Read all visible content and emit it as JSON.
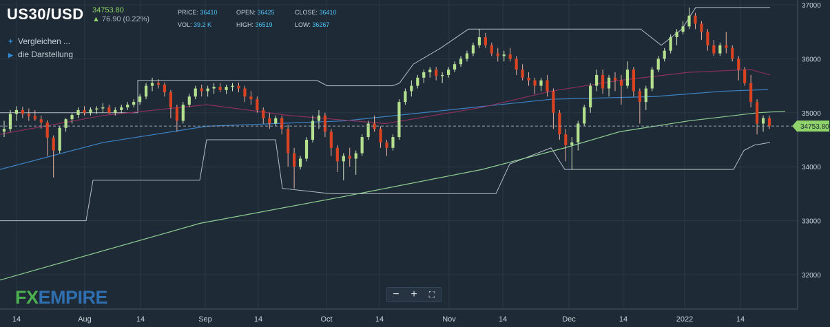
{
  "header": {
    "symbol": "US30/USD",
    "last_price": "34753.80",
    "change": "76.90 (0.22%)",
    "price_label": "PRICE:",
    "price": "36410",
    "open_label": "OPEN:",
    "open": "36425",
    "close_label": "CLOSE:",
    "close": "36410",
    "vol_label": "VOL:",
    "vol": "39.2 K",
    "high_label": "HIGH:",
    "high": "36519",
    "low_label": "LOW:",
    "low": "36267"
  },
  "menu": {
    "compare": "Vergleichen ...",
    "display": "die Darstellung"
  },
  "zoom": {
    "minus": "−",
    "plus": "+",
    "fullscreen": "⛶"
  },
  "logo": {
    "fx": "FX",
    "empire": "EMPIRE"
  },
  "colors": {
    "bg": "#1e2a36",
    "up": "#b5e08e",
    "down": "#d94322",
    "grid": "#2a3947",
    "axis_text": "#c9d1d9",
    "price_tag": "#8fd36a",
    "ma_long": "#8fcf93",
    "ma_mid": "#3d82c4",
    "ma_short": "#8a2f5c",
    "donchian": "#b7bec6"
  },
  "chart_data": {
    "type": "candlestick",
    "y_axis": {
      "min": 31500,
      "max": 37000,
      "ticks": [
        32000,
        33000,
        34000,
        35000,
        36000,
        37000
      ]
    },
    "x_labels": [
      "14",
      "Aug",
      "14",
      "Sep",
      "14",
      "Oct",
      "14",
      "Nov",
      "14",
      "Dec",
      "14",
      "2022",
      "14"
    ],
    "current_price": 34753.8,
    "current_price_label": "34753.80",
    "start": 34700,
    "candles": [
      [
        34650,
        34850,
        34550,
        34700
      ],
      [
        34700,
        35050,
        34650,
        34980
      ],
      [
        34980,
        35120,
        34850,
        35050
      ],
      [
        35050,
        35110,
        34900,
        34980
      ],
      [
        34980,
        35080,
        34850,
        34940
      ],
      [
        34940,
        35050,
        34850,
        34880
      ],
      [
        34880,
        34950,
        34700,
        34820
      ],
      [
        34820,
        34860,
        34200,
        34540
      ],
      [
        34540,
        34580,
        33800,
        34300
      ],
      [
        34300,
        34750,
        34250,
        34720
      ],
      [
        34720,
        34900,
        34650,
        34880
      ],
      [
        34880,
        35000,
        34800,
        34960
      ],
      [
        34960,
        35100,
        34900,
        35050
      ],
      [
        35050,
        35120,
        34950,
        35000
      ],
      [
        35000,
        35100,
        34950,
        35060
      ],
      [
        35060,
        35120,
        34980,
        35080
      ],
      [
        35080,
        35180,
        35000,
        35100
      ],
      [
        35100,
        35150,
        34980,
        35000
      ],
      [
        35000,
        35100,
        34950,
        35050
      ],
      [
        35050,
        35150,
        35000,
        35100
      ],
      [
        35100,
        35200,
        35050,
        35150
      ],
      [
        35150,
        35250,
        35100,
        35200
      ],
      [
        35200,
        35350,
        35150,
        35300
      ],
      [
        35300,
        35550,
        35250,
        35500
      ],
      [
        35500,
        35650,
        35400,
        35550
      ],
      [
        35550,
        35620,
        35450,
        35520
      ],
      [
        35520,
        35560,
        35300,
        35380
      ],
      [
        35380,
        35420,
        34900,
        35100
      ],
      [
        35100,
        35150,
        34650,
        34850
      ],
      [
        34850,
        35200,
        34800,
        35150
      ],
      [
        35150,
        35350,
        35100,
        35300
      ],
      [
        35300,
        35500,
        35250,
        35450
      ],
      [
        35450,
        35520,
        35300,
        35400
      ],
      [
        35400,
        35500,
        35300,
        35450
      ],
      [
        35450,
        35550,
        35350,
        35480
      ],
      [
        35480,
        35550,
        35380,
        35420
      ],
      [
        35420,
        35520,
        35350,
        35480
      ],
      [
        35480,
        35550,
        35400,
        35500
      ],
      [
        35500,
        35560,
        35380,
        35450
      ],
      [
        35450,
        35500,
        35200,
        35300
      ],
      [
        35300,
        35400,
        35150,
        35250
      ],
      [
        35250,
        35300,
        35000,
        35050
      ],
      [
        35050,
        35100,
        34800,
        34900
      ],
      [
        34900,
        35000,
        34700,
        34800
      ],
      [
        34800,
        34950,
        34750,
        34900
      ],
      [
        34900,
        34950,
        34600,
        34700
      ],
      [
        34700,
        34780,
        34000,
        34250
      ],
      [
        34250,
        34350,
        33600,
        34000
      ],
      [
        34000,
        34200,
        33950,
        34150
      ],
      [
        34150,
        34550,
        34100,
        34500
      ],
      [
        34500,
        34950,
        34450,
        34850
      ],
      [
        34850,
        35050,
        34700,
        34950
      ],
      [
        34950,
        35000,
        34550,
        34650
      ],
      [
        34650,
        34700,
        34200,
        34350
      ],
      [
        34350,
        34400,
        33900,
        34100
      ],
      [
        34100,
        34250,
        33750,
        34200
      ],
      [
        34200,
        34350,
        34000,
        34150
      ],
      [
        34150,
        34300,
        33850,
        34250
      ],
      [
        34250,
        34600,
        34200,
        34550
      ],
      [
        34550,
        34850,
        34500,
        34800
      ],
      [
        34800,
        34950,
        34650,
        34700
      ],
      [
        34700,
        34750,
        34350,
        34450
      ],
      [
        34450,
        34500,
        34200,
        34350
      ],
      [
        34350,
        34600,
        34300,
        34550
      ],
      [
        34550,
        35250,
        34500,
        35200
      ],
      [
        35200,
        35450,
        35150,
        35400
      ],
      [
        35400,
        35600,
        35300,
        35500
      ],
      [
        35500,
        35700,
        35450,
        35650
      ],
      [
        35650,
        35800,
        35550,
        35750
      ],
      [
        35750,
        35850,
        35650,
        35800
      ],
      [
        35800,
        35850,
        35600,
        35680
      ],
      [
        35680,
        35750,
        35550,
        35700
      ],
      [
        35700,
        35850,
        35650,
        35800
      ],
      [
        35800,
        35950,
        35750,
        35900
      ],
      [
        35900,
        36050,
        35850,
        36000
      ],
      [
        36000,
        36150,
        35950,
        36100
      ],
      [
        36100,
        36300,
        36050,
        36250
      ],
      [
        36250,
        36550,
        36200,
        36400
      ],
      [
        36400,
        36480,
        36200,
        36250
      ],
      [
        36250,
        36300,
        36050,
        36100
      ],
      [
        36100,
        36200,
        35950,
        36050
      ],
      [
        36050,
        36150,
        35950,
        36080
      ],
      [
        36080,
        36200,
        35950,
        36000
      ],
      [
        36000,
        36050,
        35700,
        35800
      ],
      [
        35800,
        35900,
        35600,
        35650
      ],
      [
        35650,
        35750,
        35500,
        35600
      ],
      [
        35600,
        35650,
        35350,
        35500
      ],
      [
        35500,
        35650,
        35400,
        35600
      ],
      [
        35600,
        35700,
        35300,
        35400
      ],
      [
        35400,
        35450,
        34700,
        35000
      ],
      [
        35000,
        35050,
        34500,
        34600
      ],
      [
        34600,
        34700,
        34100,
        34400
      ],
      [
        34400,
        34550,
        33950,
        34450
      ],
      [
        34450,
        34850,
        34300,
        34800
      ],
      [
        34800,
        35150,
        34750,
        35100
      ],
      [
        35100,
        35550,
        35000,
        35500
      ],
      [
        35500,
        35800,
        35400,
        35700
      ],
      [
        35700,
        35800,
        35350,
        35450
      ],
      [
        35450,
        35700,
        35300,
        35650
      ],
      [
        35650,
        35750,
        35400,
        35600
      ],
      [
        35600,
        35700,
        35150,
        35500
      ],
      [
        35500,
        35950,
        35450,
        35800
      ],
      [
        35800,
        35850,
        35300,
        35400
      ],
      [
        35400,
        35450,
        34800,
        35200
      ],
      [
        35200,
        35500,
        35050,
        35450
      ],
      [
        35450,
        35850,
        35400,
        35800
      ],
      [
        35800,
        36050,
        35750,
        36000
      ],
      [
        36000,
        36200,
        35950,
        36150
      ],
      [
        36150,
        36450,
        36100,
        36400
      ],
      [
        36400,
        36550,
        36250,
        36500
      ],
      [
        36500,
        36700,
        36450,
        36600
      ],
      [
        36600,
        36950,
        36550,
        36800
      ],
      [
        36800,
        36850,
        36550,
        36650
      ],
      [
        36650,
        36700,
        36350,
        36500
      ],
      [
        36500,
        36550,
        36150,
        36250
      ],
      [
        36250,
        36350,
        36050,
        36100
      ],
      [
        36100,
        36300,
        36050,
        36250
      ],
      [
        36250,
        36500,
        36100,
        36200
      ],
      [
        36200,
        36250,
        35950,
        36000
      ],
      [
        36000,
        36050,
        35600,
        35800
      ],
      [
        35800,
        35850,
        35500,
        35550
      ],
      [
        35550,
        35700,
        35100,
        35200
      ],
      [
        35200,
        35250,
        34600,
        34800
      ],
      [
        34800,
        34950,
        34650,
        34900
      ],
      [
        34900,
        34950,
        34700,
        34753.8
      ]
    ],
    "ma_long": [
      [
        0,
        31900
      ],
      [
        290,
        32950
      ],
      [
        500,
        33450
      ],
      [
        700,
        33950
      ],
      [
        820,
        34350
      ],
      [
        900,
        34650
      ],
      [
        1000,
        34850
      ],
      [
        1100,
        35000
      ],
      [
        1140,
        35030
      ]
    ],
    "ma_mid": [
      [
        0,
        33950
      ],
      [
        150,
        34450
      ],
      [
        300,
        34750
      ],
      [
        500,
        34850
      ],
      [
        650,
        35050
      ],
      [
        800,
        35250
      ],
      [
        950,
        35300
      ],
      [
        1050,
        35400
      ],
      [
        1115,
        35430
      ]
    ],
    "ma_short": [
      [
        0,
        34600
      ],
      [
        150,
        34950
      ],
      [
        300,
        35150
      ],
      [
        420,
        34950
      ],
      [
        560,
        34800
      ],
      [
        700,
        35100
      ],
      [
        800,
        35400
      ],
      [
        900,
        35600
      ],
      [
        1000,
        35750
      ],
      [
        1090,
        35800
      ],
      [
        1118,
        35700
      ]
    ],
    "don_upper": [
      [
        0,
        35000
      ],
      [
        200,
        35000
      ],
      [
        200,
        35600
      ],
      [
        460,
        35600
      ],
      [
        475,
        35500
      ],
      [
        570,
        35500
      ],
      [
        580,
        35550
      ],
      [
        600,
        35900
      ],
      [
        640,
        36200
      ],
      [
        680,
        36550
      ],
      [
        930,
        36550
      ],
      [
        960,
        36250
      ],
      [
        990,
        36550
      ],
      [
        1010,
        36950
      ],
      [
        1118,
        36950
      ]
    ],
    "don_lower": [
      [
        0,
        33000
      ],
      [
        125,
        33000
      ],
      [
        135,
        33750
      ],
      [
        290,
        33750
      ],
      [
        300,
        34500
      ],
      [
        400,
        34500
      ],
      [
        410,
        33600
      ],
      [
        480,
        33500
      ],
      [
        720,
        33500
      ],
      [
        740,
        34050
      ],
      [
        800,
        34350
      ],
      [
        820,
        33950
      ],
      [
        1065,
        33950
      ],
      [
        1080,
        34300
      ],
      [
        1095,
        34400
      ],
      [
        1118,
        34450
      ]
    ],
    "dot_line_price": 34753.8
  }
}
